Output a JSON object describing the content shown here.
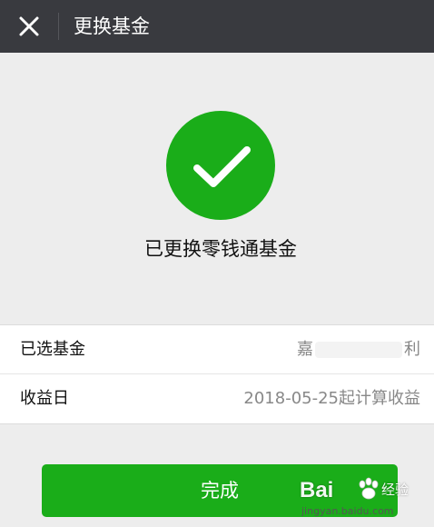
{
  "header": {
    "title": "更换基金",
    "close_icon": "close-icon"
  },
  "status": {
    "icon": "checkmark-icon",
    "message": "已更换零钱通基金",
    "color": "#1aad19"
  },
  "info": {
    "rows": [
      {
        "label": "已选基金",
        "value_left": "嘉",
        "value_right": "利"
      },
      {
        "label": "收益日",
        "value": "2018-05-25起计算收益"
      }
    ]
  },
  "footer": {
    "done_label": "完成"
  },
  "watermark": {
    "brand": "Bai",
    "cn": "经验",
    "url": "jingyan.baidu.com"
  },
  "colors": {
    "topbar": "#393a3f",
    "accent": "#1aad19",
    "background": "#ededed"
  }
}
